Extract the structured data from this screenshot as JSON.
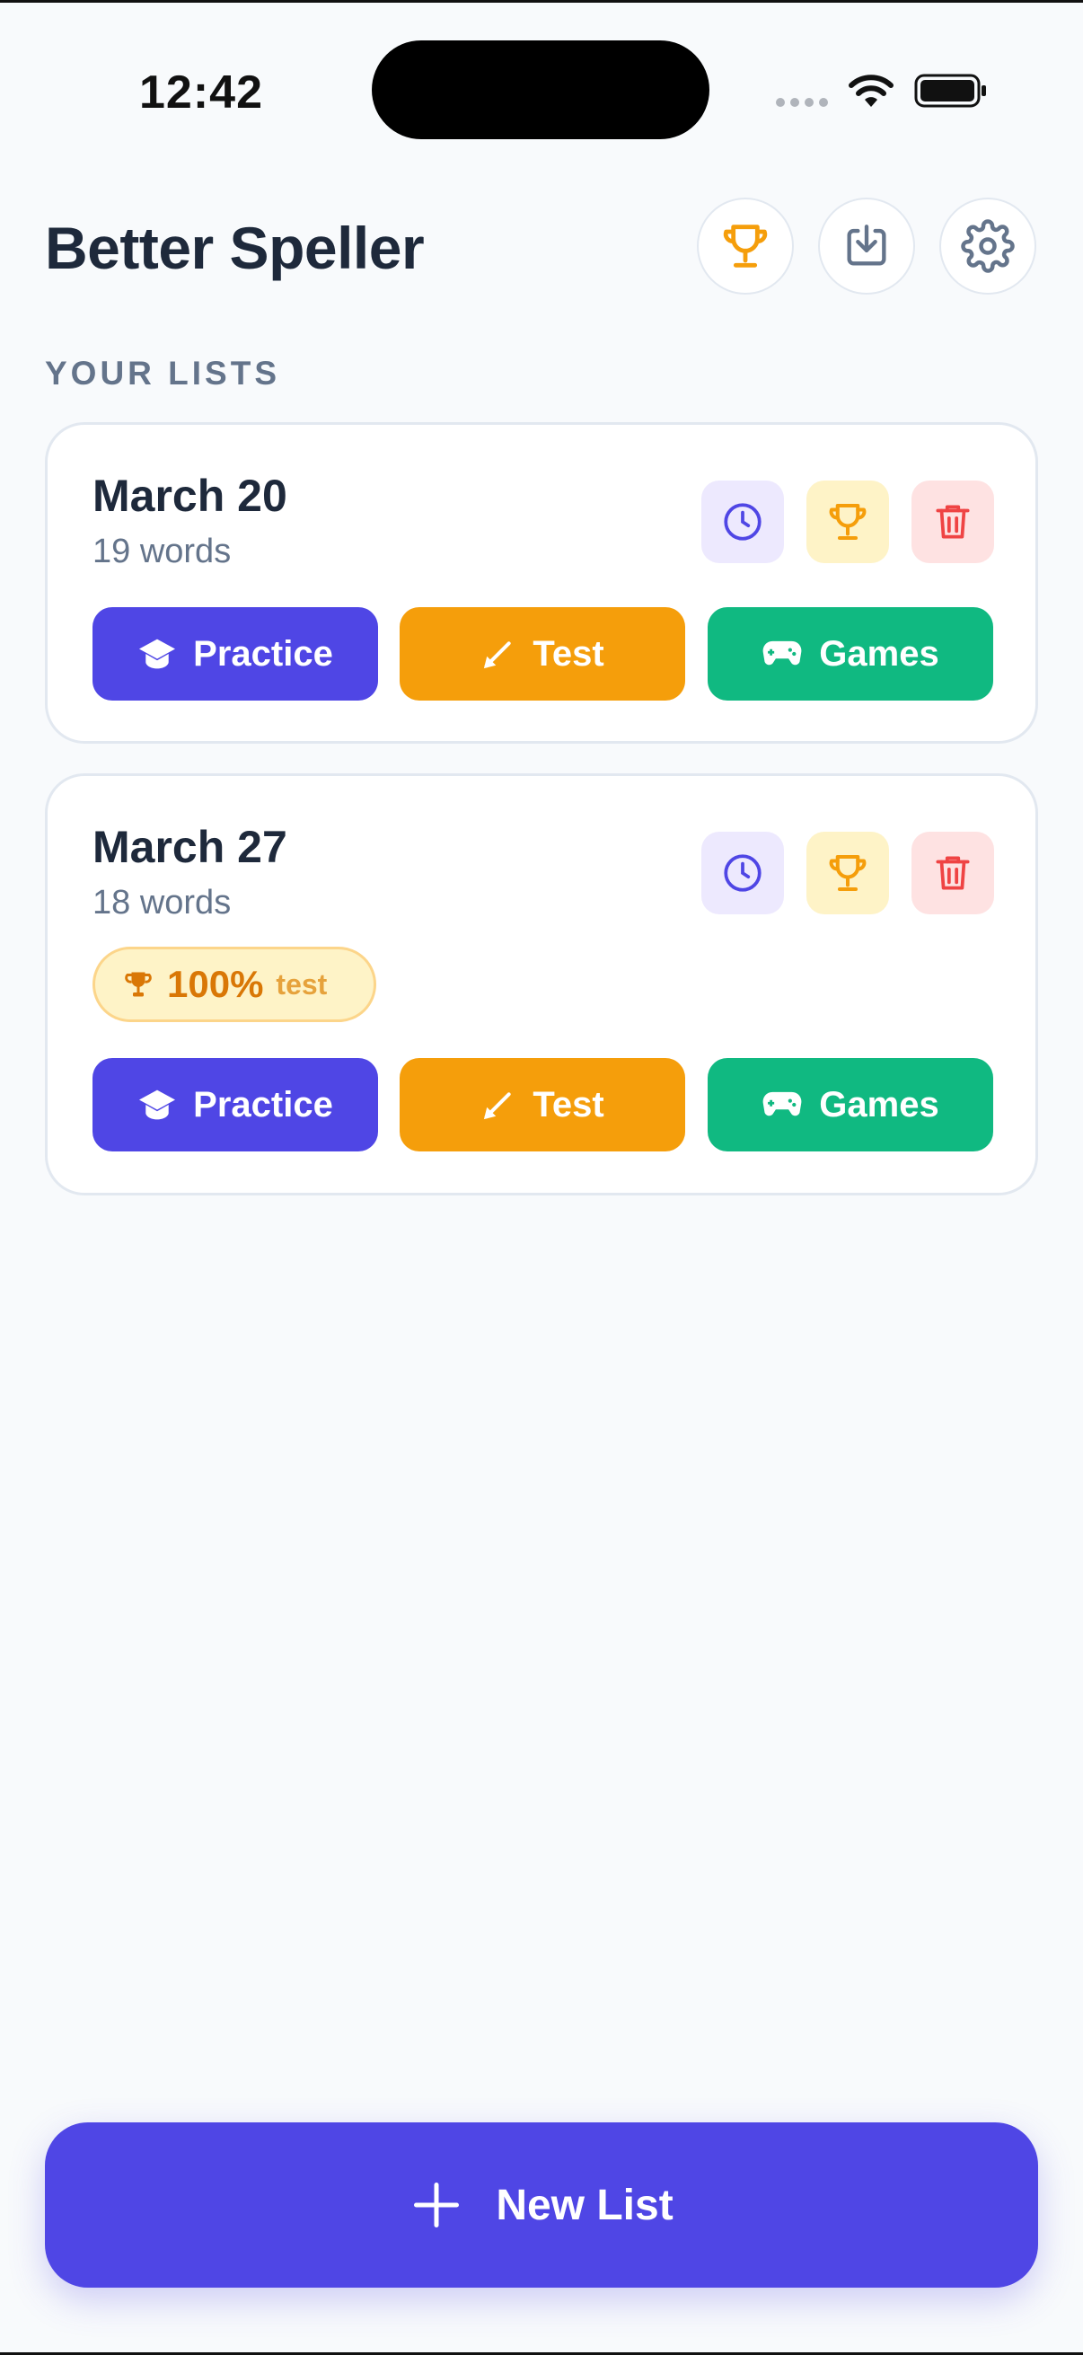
{
  "status": {
    "time": "12:42"
  },
  "header": {
    "title": "Better Speller"
  },
  "section": {
    "label": "YOUR LISTS"
  },
  "lists": [
    {
      "title": "March 20",
      "word_count": "19 words",
      "actions": {
        "practice": "Practice",
        "test": "Test",
        "games": "Games"
      }
    },
    {
      "title": "March 27",
      "word_count": "18 words",
      "badge": {
        "score": "100%",
        "label": "test"
      },
      "actions": {
        "practice": "Practice",
        "test": "Test",
        "games": "Games"
      }
    }
  ],
  "footer": {
    "new_list_label": "New List"
  },
  "icons": [
    "trophy-icon",
    "download-icon",
    "gear-icon",
    "clock-icon",
    "trash-icon",
    "graduation-cap-icon",
    "pencil-icon",
    "gamepad-icon",
    "plus-icon"
  ],
  "colors": {
    "primary": "#4f46e5",
    "test": "#f59e0b",
    "games": "#10b981",
    "delete": "#ef4444",
    "trophy": "#f59e0b"
  }
}
